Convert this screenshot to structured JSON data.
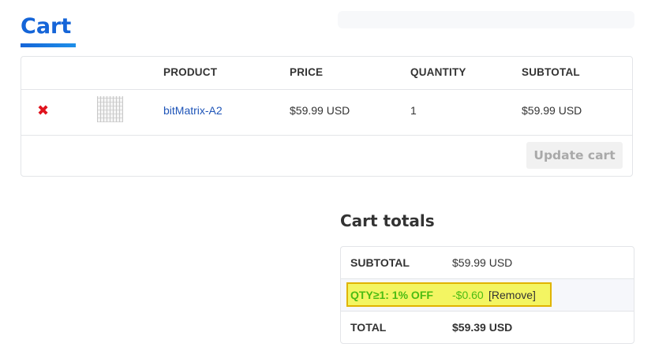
{
  "page": {
    "title": "Cart"
  },
  "cart_table": {
    "headers": {
      "product": "PRODUCT",
      "price": "PRICE",
      "quantity": "QUANTITY",
      "subtotal": "SUBTOTAL"
    },
    "rows": [
      {
        "remove_icon": "✖",
        "thumbnail": "product-thumbnail",
        "product": "bitMatrix-A2",
        "price": "$59.99 USD",
        "quantity": "1",
        "subtotal": "$59.99 USD"
      }
    ],
    "update_button": "Update cart"
  },
  "cart_totals": {
    "title": "Cart totals",
    "subtotal_label": "SUBTOTAL",
    "subtotal_value": "$59.99 USD",
    "coupon_label": "QTY≥1: 1% OFF",
    "coupon_amount": "-$0.60",
    "coupon_remove": "[Remove]",
    "total_label": "TOTAL",
    "total_value": "$59.39 USD"
  },
  "colors": {
    "accent": "#1565d8",
    "remove_red": "#e0141e",
    "discount_green": "#4cbc12",
    "highlight_yellow": "#f3f562"
  },
  "icons": {
    "remove": "close-icon"
  }
}
